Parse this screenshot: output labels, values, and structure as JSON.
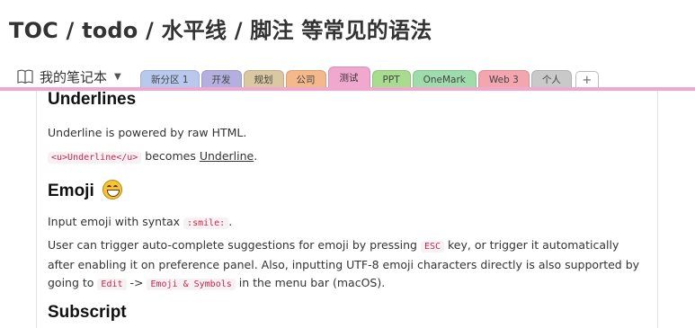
{
  "page": {
    "title": "TOC / todo / 水平线 / 脚注 等常见的语法"
  },
  "notebook": {
    "icon": "notebook-icon",
    "label": "我的笔记本",
    "caret": "▼"
  },
  "tabs": [
    {
      "label": "新分区 1",
      "color": "#b9c9ee"
    },
    {
      "label": "开发",
      "color": "#b3b0df"
    },
    {
      "label": "规划",
      "color": "#d9c8a2"
    },
    {
      "label": "公司",
      "color": "#f3b98a"
    },
    {
      "label": "测试",
      "color": "#f0a8cf",
      "active": true
    },
    {
      "label": "PPT",
      "color": "#a8dc8e"
    },
    {
      "label": "OneMark",
      "color": "#9fdcab"
    },
    {
      "label": "Web 3",
      "color": "#f3a6ad"
    },
    {
      "label": "个人",
      "color": "#c9c9c9"
    }
  ],
  "tab_add_label": "+",
  "accent_color": "#f0a8cf",
  "sections": {
    "underlines": {
      "heading": "Underlines",
      "line1": "Underline is powered by raw HTML.",
      "code": "<u>Underline</u>",
      "becomes": " becomes ",
      "underlined": "Underline",
      "period": "."
    },
    "emoji": {
      "heading": "Emoji",
      "icon": "smile-emoji-icon",
      "p1_before": "Input emoji with syntax ",
      "p1_code": ":smile:",
      "p1_after": ".",
      "p2_a": "User can trigger auto-complete suggestions for emoji by pressing ",
      "p2_code1": "ESC",
      "p2_b": " key, or trigger it automatically after enabling it on preference panel. Also, inputting UTF-8 emoji characters directly is also supported by going to ",
      "p2_code2": "Edit",
      "p2_c": " -> ",
      "p2_code3": "Emoji & Symbols",
      "p2_d": " in the menu bar (macOS)."
    },
    "subscript": {
      "heading": "Subscript"
    }
  }
}
